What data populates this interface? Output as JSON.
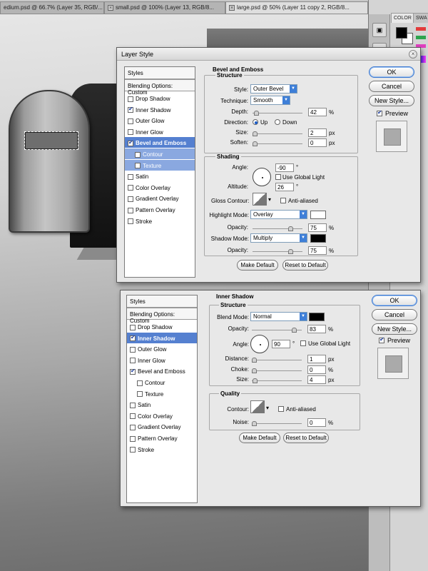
{
  "document_tabs": [
    {
      "label": "edium.psd @ 66.7% (Layer 35, RGB/...",
      "active": false
    },
    {
      "label": "small.psd @ 100% (Layer 13, RGB/8...",
      "active": false
    },
    {
      "label": "large.psd @ 50% (Layer 11 copy 2, RGB/8...",
      "active": true
    }
  ],
  "right_panel": {
    "tabs": [
      "COLOR",
      "SWA"
    ],
    "swatch_colors": {
      "foreground": "#000000",
      "background": "#ffffff"
    }
  },
  "dialog1": {
    "title": "Layer Style",
    "styles_header": "Styles",
    "blending_options": "Blending Options: Custom",
    "items": [
      {
        "label": "Drop Shadow",
        "checked": false,
        "selected": false,
        "sub": false
      },
      {
        "label": "Inner Shadow",
        "checked": true,
        "selected": false,
        "sub": false
      },
      {
        "label": "Outer Glow",
        "checked": false,
        "selected": false,
        "sub": false
      },
      {
        "label": "Inner Glow",
        "checked": false,
        "selected": false,
        "sub": false
      },
      {
        "label": "Bevel and Emboss",
        "checked": true,
        "selected": true,
        "sub": false
      },
      {
        "label": "Contour",
        "checked": false,
        "selected": false,
        "sub": true
      },
      {
        "label": "Texture",
        "checked": false,
        "selected": false,
        "sub": true
      },
      {
        "label": "Satin",
        "checked": false,
        "selected": false,
        "sub": false
      },
      {
        "label": "Color Overlay",
        "checked": false,
        "selected": false,
        "sub": false
      },
      {
        "label": "Gradient Overlay",
        "checked": false,
        "selected": false,
        "sub": false
      },
      {
        "label": "Pattern Overlay",
        "checked": false,
        "selected": false,
        "sub": false
      },
      {
        "label": "Stroke",
        "checked": false,
        "selected": false,
        "sub": false
      }
    ],
    "section_title": "Bevel and Emboss",
    "structure_title": "Structure",
    "style_label": "Style:",
    "style_value": "Outer Bevel",
    "technique_label": "Technique:",
    "technique_value": "Smooth",
    "depth_label": "Depth:",
    "depth_value": "42",
    "depth_unit": "%",
    "direction_label": "Direction:",
    "dir_up": "Up",
    "dir_down": "Down",
    "size_label": "Size:",
    "size_value": "2",
    "size_unit": "px",
    "soften_label": "Soften:",
    "soften_value": "0",
    "soften_unit": "px",
    "shading_title": "Shading",
    "angle_label": "Angle:",
    "angle_value": "-90",
    "angle_unit": "°",
    "global_light": "Use Global Light",
    "altitude_label": "Altitude:",
    "altitude_value": "26",
    "altitude_unit": "°",
    "gloss_label": "Gloss Contour:",
    "anti_aliased": "Anti-aliased",
    "highlight_label": "Highlight Mode:",
    "highlight_value": "Overlay",
    "highlight_color": "#ffffff",
    "hl_opacity_label": "Opacity:",
    "hl_opacity_value": "75",
    "hl_opacity_unit": "%",
    "shadow_label": "Shadow Mode:",
    "shadow_value": "Multiply",
    "shadow_color": "#000000",
    "sh_opacity_label": "Opacity:",
    "sh_opacity_value": "75",
    "sh_opacity_unit": "%",
    "make_default": "Make Default",
    "reset_default": "Reset to Default",
    "ok": "OK",
    "cancel": "Cancel",
    "new_style": "New Style...",
    "preview": "Preview"
  },
  "dialog2": {
    "styles_header": "Styles",
    "blending_options": "Blending Options: Custom",
    "items": [
      {
        "label": "Drop Shadow",
        "checked": false,
        "selected": false,
        "sub": false
      },
      {
        "label": "Inner Shadow",
        "checked": true,
        "selected": true,
        "sub": false
      },
      {
        "label": "Outer Glow",
        "checked": false,
        "selected": false,
        "sub": false
      },
      {
        "label": "Inner Glow",
        "checked": false,
        "selected": false,
        "sub": false
      },
      {
        "label": "Bevel and Emboss",
        "checked": true,
        "selected": false,
        "sub": false
      },
      {
        "label": "Contour",
        "checked": false,
        "selected": false,
        "sub": true
      },
      {
        "label": "Texture",
        "checked": false,
        "selected": false,
        "sub": true
      },
      {
        "label": "Satin",
        "checked": false,
        "selected": false,
        "sub": false
      },
      {
        "label": "Color Overlay",
        "checked": false,
        "selected": false,
        "sub": false
      },
      {
        "label": "Gradient Overlay",
        "checked": false,
        "selected": false,
        "sub": false
      },
      {
        "label": "Pattern Overlay",
        "checked": false,
        "selected": false,
        "sub": false
      },
      {
        "label": "Stroke",
        "checked": false,
        "selected": false,
        "sub": false
      }
    ],
    "section_title": "Inner Shadow",
    "structure_title": "Structure",
    "blend_label": "Blend Mode:",
    "blend_value": "Normal",
    "blend_color": "#000000",
    "opacity_label": "Opacity:",
    "opacity_value": "83",
    "opacity_unit": "%",
    "angle_label": "Angle:",
    "angle_value": "90",
    "angle_unit": "°",
    "global_light": "Use Global Light",
    "distance_label": "Distance:",
    "distance_value": "1",
    "distance_unit": "px",
    "choke_label": "Choke:",
    "choke_value": "0",
    "choke_unit": "%",
    "size_label": "Size:",
    "size_value": "4",
    "size_unit": "px",
    "quality_title": "Quality",
    "contour_label": "Contour:",
    "anti_aliased": "Anti-aliased",
    "noise_label": "Noise:",
    "noise_value": "0",
    "noise_unit": "%",
    "make_default": "Make Default",
    "reset_default": "Reset to Default",
    "ok": "OK",
    "cancel": "Cancel",
    "new_style": "New Style...",
    "preview": "Preview"
  }
}
